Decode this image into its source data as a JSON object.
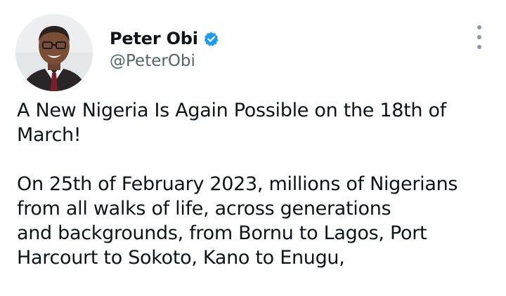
{
  "author": {
    "display_name": "Peter Obi",
    "handle": "@PeterObi",
    "verified_badge_icon": "verified-check-icon",
    "badge_color": "#1d9bf0"
  },
  "menu": {
    "icon": "more-vertical-icon"
  },
  "tweet": {
    "paragraph_1": [
      "A New Nigeria Is Again Possible on the 18th of",
      "March!"
    ],
    "paragraph_2": [
      "On 25th of February 2023, millions of Nigerians",
      "from all walks of life, across generations",
      "and backgrounds, from Bornu to Lagos, Port",
      "Harcourt to Sokoto, Kano to Enugu,"
    ]
  },
  "colors": {
    "text_primary": "#0f1419",
    "text_secondary": "#536471",
    "accent": "#1d9bf0"
  }
}
